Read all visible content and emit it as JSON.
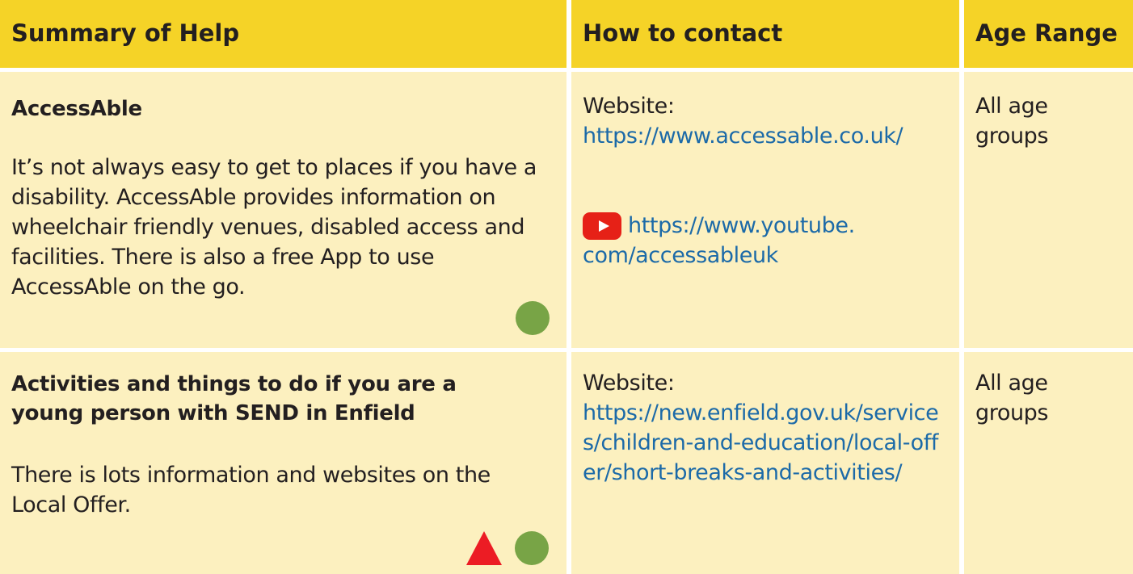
{
  "headers": {
    "summary": "Summary of Help",
    "contact": "How to contact",
    "age": "Age Range"
  },
  "rows": [
    {
      "title": "AccessAble",
      "description": "It’s not always easy to get to places if you have a disability. AccessAble provides information on wheelchair friendly venues, disabled access and facilities. There is also a free App to use AccessAble on the go.",
      "website_label": "Website:",
      "website_url": "https://www.accessable.co.uk/",
      "youtube_url_line1": "https://www.youtube.",
      "youtube_url_line2": "com/accessableuk",
      "age": "All age groups",
      "symbols": [
        "green-circle"
      ]
    },
    {
      "title": "Activities and things to do if you are a young person with SEND in Enfield",
      "description": "There is lots information and websites on the Local Offer.",
      "website_label": "Website:",
      "website_url": "https://new.enfield.gov.uk/services/children-and-education/local-offer/short-breaks-and-activities/",
      "age": "All age groups",
      "symbols": [
        "red-triangle",
        "green-circle"
      ]
    }
  ],
  "colors": {
    "header_bg": "#f5d327",
    "row_bg": "#fcf0bf",
    "link": "#1c6aa8",
    "green_symbol": "#78a446",
    "red_symbol": "#ec1c24",
    "youtube": "#e62117"
  },
  "icons": {
    "youtube": "youtube-icon"
  }
}
